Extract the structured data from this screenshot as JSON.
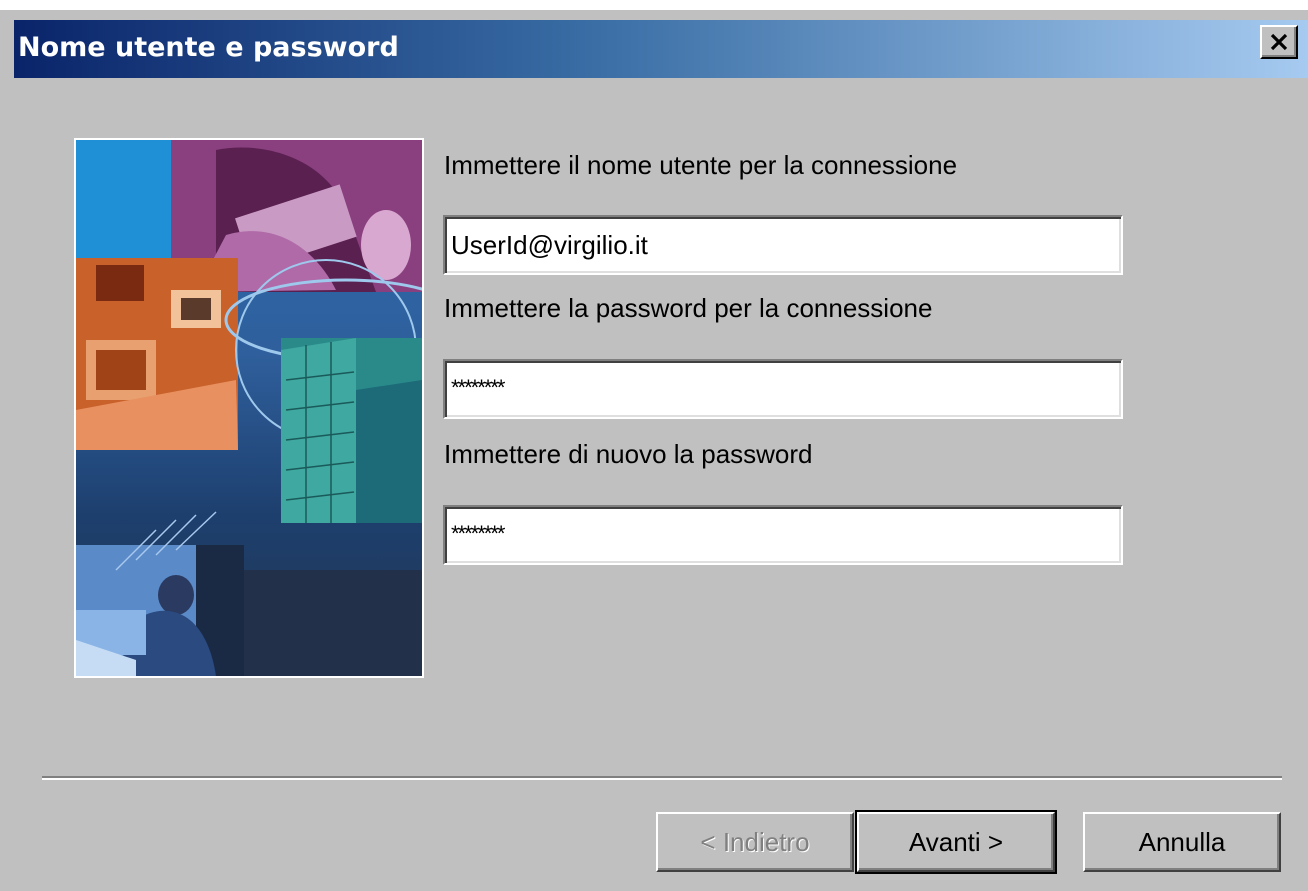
{
  "window": {
    "title": "Nome utente e password"
  },
  "form": {
    "username_label": "Immettere il nome utente per la connessione",
    "username_value": "UserId@virgilio.it",
    "password_label": "Immettere la password per la connessione",
    "password_value": "********",
    "confirm_label": "Immettere di nuovo la password",
    "confirm_value": "********"
  },
  "buttons": {
    "back_label": "< Indietro",
    "next_label": "Avanti >",
    "cancel_label": "Annulla"
  },
  "colors": {
    "title_start": "#0a246a",
    "title_end": "#a6caf0",
    "dialog_bg": "#c0c0c0"
  }
}
